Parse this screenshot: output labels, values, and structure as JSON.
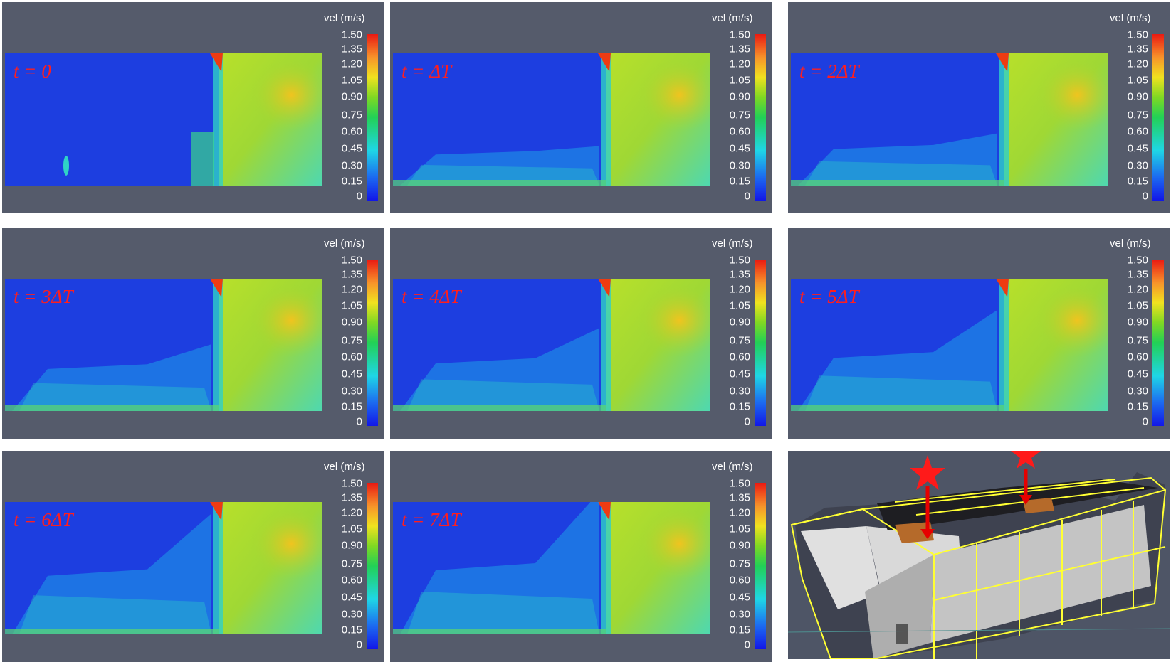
{
  "colorbar": {
    "title": "vel (m/s)",
    "ticks": [
      "1.50",
      "1.35",
      "1.20",
      "1.05",
      "0.90",
      "0.75",
      "0.60",
      "0.45",
      "0.30",
      "0.15",
      "0"
    ]
  },
  "panels": [
    {
      "time_label": "t = 0"
    },
    {
      "time_label": "t = ΔT"
    },
    {
      "time_label": "t = 2ΔT"
    },
    {
      "time_label": "t = 3ΔT"
    },
    {
      "time_label": "t = 4ΔT"
    },
    {
      "time_label": "t = 5ΔT"
    },
    {
      "time_label": "t = 6ΔT"
    },
    {
      "time_label": "t = 7ΔT"
    }
  ],
  "colors": {
    "background": "#555b6b",
    "low_velocity": "#1d3ee0",
    "high_velocity": "#ea1a12",
    "label": "#ff1e1e",
    "model_outline": "#ffff33"
  },
  "render3d": {
    "description_icon": "star-icon",
    "marker_count": 2
  }
}
